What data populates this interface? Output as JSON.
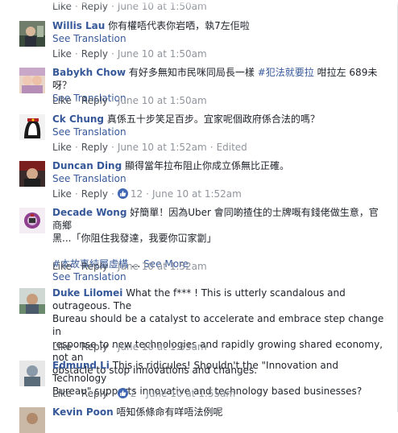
{
  "labels": {
    "like": "Like",
    "reply": "Reply",
    "see_translation": "See Translation",
    "see_more": "See More",
    "edited": "Edited"
  },
  "top_row": {
    "time": "June 10 at 1:50am"
  },
  "comments": [
    {
      "name": "Willis Lau",
      "text": "你有權唔代表你岩哂，執7左佢啦",
      "time": "June 10 at 1:50am"
    },
    {
      "name": "Babykh Chow",
      "text": "有好多無知市民咪同局長一樣",
      "hashtag": "#犯法就要拉",
      "text_after": "咁拉左 689未呀？",
      "time": "June 10 at 1:50am"
    },
    {
      "name": "Ck Chung",
      "text": "真係五十步笑足百步。宜家呢個政府係合法的嗎？",
      "time": "June 10 at 1:52am"
    },
    {
      "name": "Duncan Ding",
      "text": "顯得當年拉布阻止你成立係無比正確。",
      "likes": "12",
      "time": "June 10 at 1:52am"
    },
    {
      "name": "Decade Wong",
      "text_line1": "好簡單！因為Uber 會同啲揸住的士牌嘅有錢佬做生意，官商鄉",
      "text_line2": "黑...「你阻住我發達，我要你冚家劏」",
      "hashtag": "#本故事純屬虛構",
      "ellipsis": " ... ",
      "time": "June 10 at 1:52am"
    },
    {
      "name": "Duke Lilomei",
      "text_line1": "What the f*** ! This is utterly scandalous and outrageous. The",
      "text_line2": "Bureau should be a catalyst to accelerate and embrace step change in",
      "text_line3": "response to new technologies and rapidly growing shared economy, not an",
      "text_line4": "obstacle to stop innovations and changes.",
      "time": "June 10 at 1:53am"
    },
    {
      "name": "Edmund Li",
      "text_line1": "This is ridicules! Shouldn't the \"Innovation and Technology",
      "text_line2": "Bureau\" supports innovative and technology based businesses?",
      "likes": "2",
      "time": "June 10 at 1:55am"
    },
    {
      "name": "Kevin Poon",
      "text": "唔知係條命有咩唔法例呢"
    }
  ],
  "colors": {
    "link_blue": "#365899",
    "meta_gray": "#90949c",
    "text_dark": "#1d2129",
    "like_blue": "#4267b2"
  }
}
